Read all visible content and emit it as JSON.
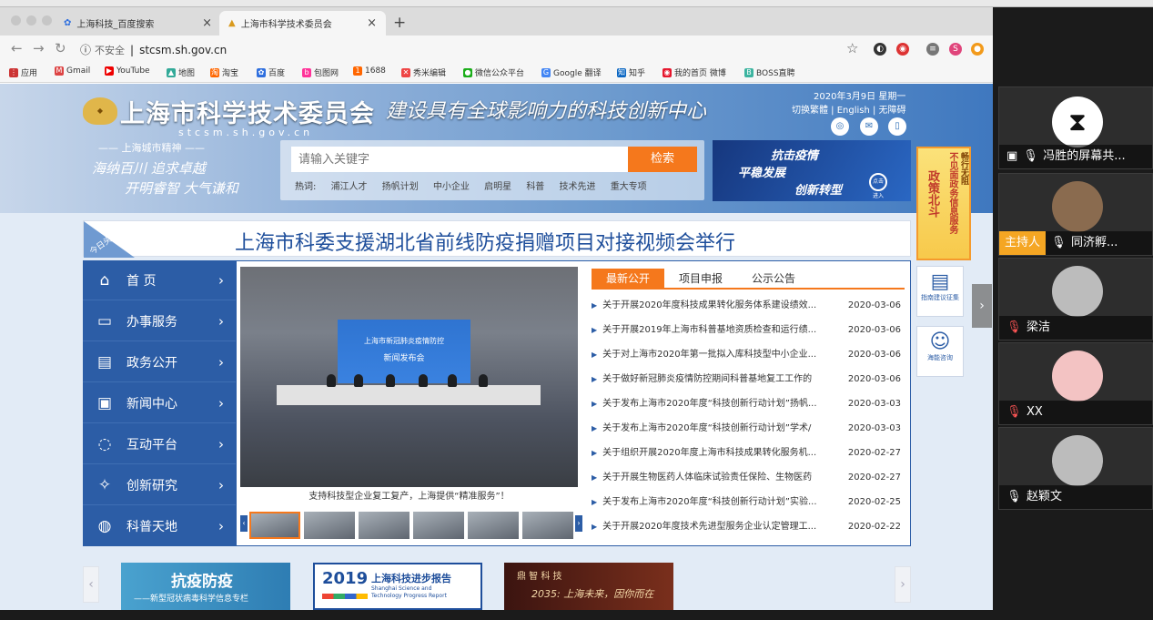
{
  "browser": {
    "tabs": [
      {
        "title": "上海科技_百度搜索",
        "close": "×"
      },
      {
        "title": "上海市科学技术委员会",
        "close": "×"
      }
    ],
    "new_tab": "+",
    "url_label": "不安全",
    "url": "stcsm.sh.gov.cn",
    "bookmarks": [
      "应用",
      "Gmail",
      "YouTube",
      "地图",
      "淘宝",
      "百度",
      "包图网",
      "1688",
      "秀米编辑",
      "微信公众平台",
      "Google 翻译",
      "知乎",
      "我的首页 微博",
      "BOSS直聘"
    ]
  },
  "site": {
    "title": "上海市科学技术委员会",
    "subtitle": "stcsm.sh.gov.cn",
    "slogan": "建设具有全球影响力的科技创新中心",
    "date": "2020年3月9日 星期一",
    "lang_links": "切换繁體 | English | 无障碍",
    "spirit_heading": "—— 上海城市精神 ——",
    "spirit_line1": "海纳百川  追求卓越",
    "spirit_line2": "开明睿智  大气谦和",
    "search_placeholder": "请输入关键字",
    "search_button": "检索",
    "hot_label": "热词:",
    "hot_words": [
      "浦江人才",
      "扬帆计划",
      "中小企业",
      "启明星",
      "科普",
      "技术先进",
      "重大专项"
    ],
    "promo_line1": "抗击疫情",
    "promo_line2": "平稳发展",
    "promo_line3": "创新转型",
    "promo_enter": "点击进入",
    "side_banner_a": "不见面政务信息服务",
    "side_banner_b": "政策北斗",
    "side_banner_c": "畅行无阻",
    "headline_badge": "今日头条",
    "headline": "上海市科委支援湖北省前线防疫捐赠项目对接视频会举行"
  },
  "side_nav": [
    {
      "label": "首    页",
      "icon": "⌂"
    },
    {
      "label": "办事服务",
      "icon": "▭"
    },
    {
      "label": "政务公开",
      "icon": "▤"
    },
    {
      "label": "新闻中心",
      "icon": "▣"
    },
    {
      "label": "互动平台",
      "icon": "◌"
    },
    {
      "label": "创新研究",
      "icon": "✧"
    },
    {
      "label": "科普天地",
      "icon": "◍"
    }
  ],
  "photo": {
    "screen_line1": "上海市新冠肺炎疫情防控",
    "screen_line2": "新闻发布会",
    "caption": "支持科技型企业复工复产，上海提供“精准服务”！"
  },
  "list_tabs": [
    "最新公开",
    "项目申报",
    "公示公告"
  ],
  "news": [
    {
      "title": "关于开展2020年度科技成果转化服务体系建设绩效...",
      "date": "2020-03-06"
    },
    {
      "title": "关于开展2019年上海市科普基地资质检查和运行绩...",
      "date": "2020-03-06"
    },
    {
      "title": "关于对上海市2020年第一批拟入库科技型中小企业...",
      "date": "2020-03-06"
    },
    {
      "title": "关于做好新冠肺炎疫情防控期间科普基地复工工作的",
      "date": "2020-03-06"
    },
    {
      "title": "关于发布上海市2020年度“科技创新行动计划”扬帆...",
      "date": "2020-03-03"
    },
    {
      "title": "关于发布上海市2020年度“科技创新行动计划”学术/",
      "date": "2020-03-03"
    },
    {
      "title": "关于组织开展2020年度上海市科技成果转化服务机...",
      "date": "2020-02-27"
    },
    {
      "title": "关于开展生物医药人体临床试验责任保险、生物医药",
      "date": "2020-02-27"
    },
    {
      "title": "关于发布上海市2020年度“科技创新行动计划”实验...",
      "date": "2020-02-25"
    },
    {
      "title": "关于开展2020年度技术先进型服务企业认定管理工...",
      "date": "2020-02-22"
    }
  ],
  "side_cards": [
    {
      "label": "指南建议征集"
    },
    {
      "label": "海能咨询"
    }
  ],
  "bottom_cards": {
    "card1_title": "抗疫防疫",
    "card1_sub": "——新型冠状病毒科学信息专栏",
    "card2_year": "2019",
    "card2_title": "上海科技进步报告",
    "card2_en1": "Shanghai Science and",
    "card2_en2": "Technology Progress Report",
    "card3_title": "鼎 智 科 技",
    "card3_sub": "2035: 上海未来，因你而在"
  },
  "meeting": {
    "participants": [
      {
        "name": "冯胜的屏幕共..."
      },
      {
        "name": "同济孵...",
        "tag": "主持人"
      },
      {
        "name": "梁洁"
      },
      {
        "name": "XX"
      },
      {
        "name": "赵颖文"
      }
    ]
  },
  "colors": {
    "nav_blue": "#2c5da6",
    "accent_orange": "#f5781c",
    "headline_blue": "#1e4e9b"
  }
}
